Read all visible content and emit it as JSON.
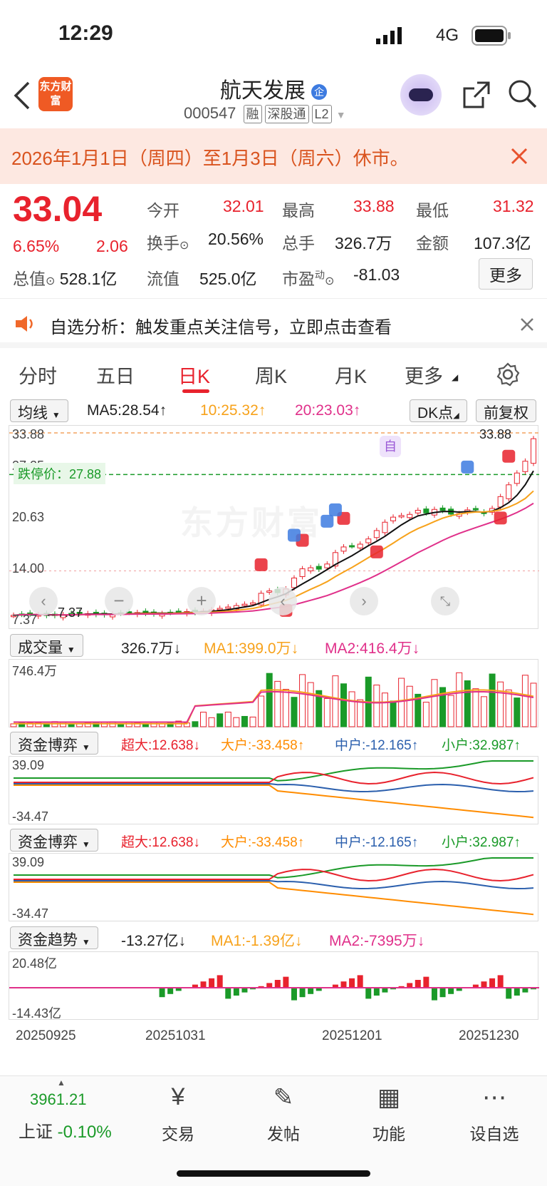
{
  "status": {
    "time": "12:29",
    "network": "4G"
  },
  "header": {
    "title": "航天发展",
    "code": "000547",
    "tags": [
      "融",
      "深股通",
      "L2"
    ],
    "logo": "东方财富"
  },
  "notice": {
    "text": "2026年1月1日（周四）至1月3日（周六）休市。"
  },
  "quote": {
    "price": "33.04",
    "change_pct": "6.65%",
    "change": "2.06",
    "open_label": "今开",
    "open": "32.01",
    "high_label": "最高",
    "high": "33.88",
    "low_label": "最低",
    "low": "31.32",
    "turnover_label": "换手",
    "turnover": "20.56%",
    "volume_label": "总手",
    "volume": "326.7万",
    "amount_label": "金额",
    "amount": "107.3亿",
    "mktcap_label": "总值",
    "mktcap": "528.1亿",
    "float_label": "流值",
    "float": "525.0亿",
    "pe_label": "市盈",
    "pe_sup": "动",
    "pe": "-81.03",
    "more": "更多"
  },
  "analysis": {
    "text": "自选分析：触发重点关注信号，立即点击查看"
  },
  "tabs": [
    "分时",
    "五日",
    "日K",
    "周K",
    "月K",
    "更多"
  ],
  "active_tab": "日K",
  "kline": {
    "selector": "均线",
    "ma5": "MA5:28.54↑",
    "ma10": "10:25.32↑",
    "ma20": "20:23.03↑",
    "dk_button": "DK点",
    "adjust_button": "前复权",
    "y_labels": [
      "33.88",
      "27.25",
      "20.63",
      "14.00",
      "7.37"
    ],
    "high_marker": "33.88",
    "low_marker": "7.37",
    "limit_label": "跌停价：27.88",
    "watermark": "东方财富",
    "marker_self": "自"
  },
  "volume": {
    "selector": "成交量",
    "value": "326.7万↓",
    "ma1": "MA1:399.0万↓",
    "ma2": "MA2:416.4万↓",
    "top": "746.4万"
  },
  "fund1": {
    "selector": "资金博弈",
    "super": "超大:12.638↓",
    "large": "大户:-33.458↑",
    "mid": "中户:-12.165↑",
    "small": "小户:32.987↑",
    "top": "39.09",
    "bottom": "-34.47"
  },
  "fund2": {
    "selector": "资金博弈",
    "super": "超大:12.638↓",
    "large": "大户:-33.458↑",
    "mid": "中户:-12.165↑",
    "small": "小户:32.987↑",
    "top": "39.09",
    "bottom": "-34.47"
  },
  "trend": {
    "selector": "资金趋势",
    "value": "-13.27亿↓",
    "ma1": "MA1:-1.39亿↓",
    "ma2": "MA2:-7395万↓",
    "top": "20.48亿",
    "bottom": "-14.43亿"
  },
  "dates": [
    "20250925",
    "20251031",
    "20251201",
    "20251230"
  ],
  "bottom_nav": {
    "index_value": "3961.21",
    "index_name": "上证",
    "index_change": "-0.10%",
    "items": [
      "交易",
      "发帖",
      "功能",
      "设自选"
    ]
  },
  "colors": {
    "up": "#e8222d",
    "down": "#1a9a28",
    "ma5": "#111111",
    "ma10": "#f7a21b",
    "ma20": "#e0308a",
    "mid": "#2b5fad",
    "orange": "#ff8c00"
  }
}
